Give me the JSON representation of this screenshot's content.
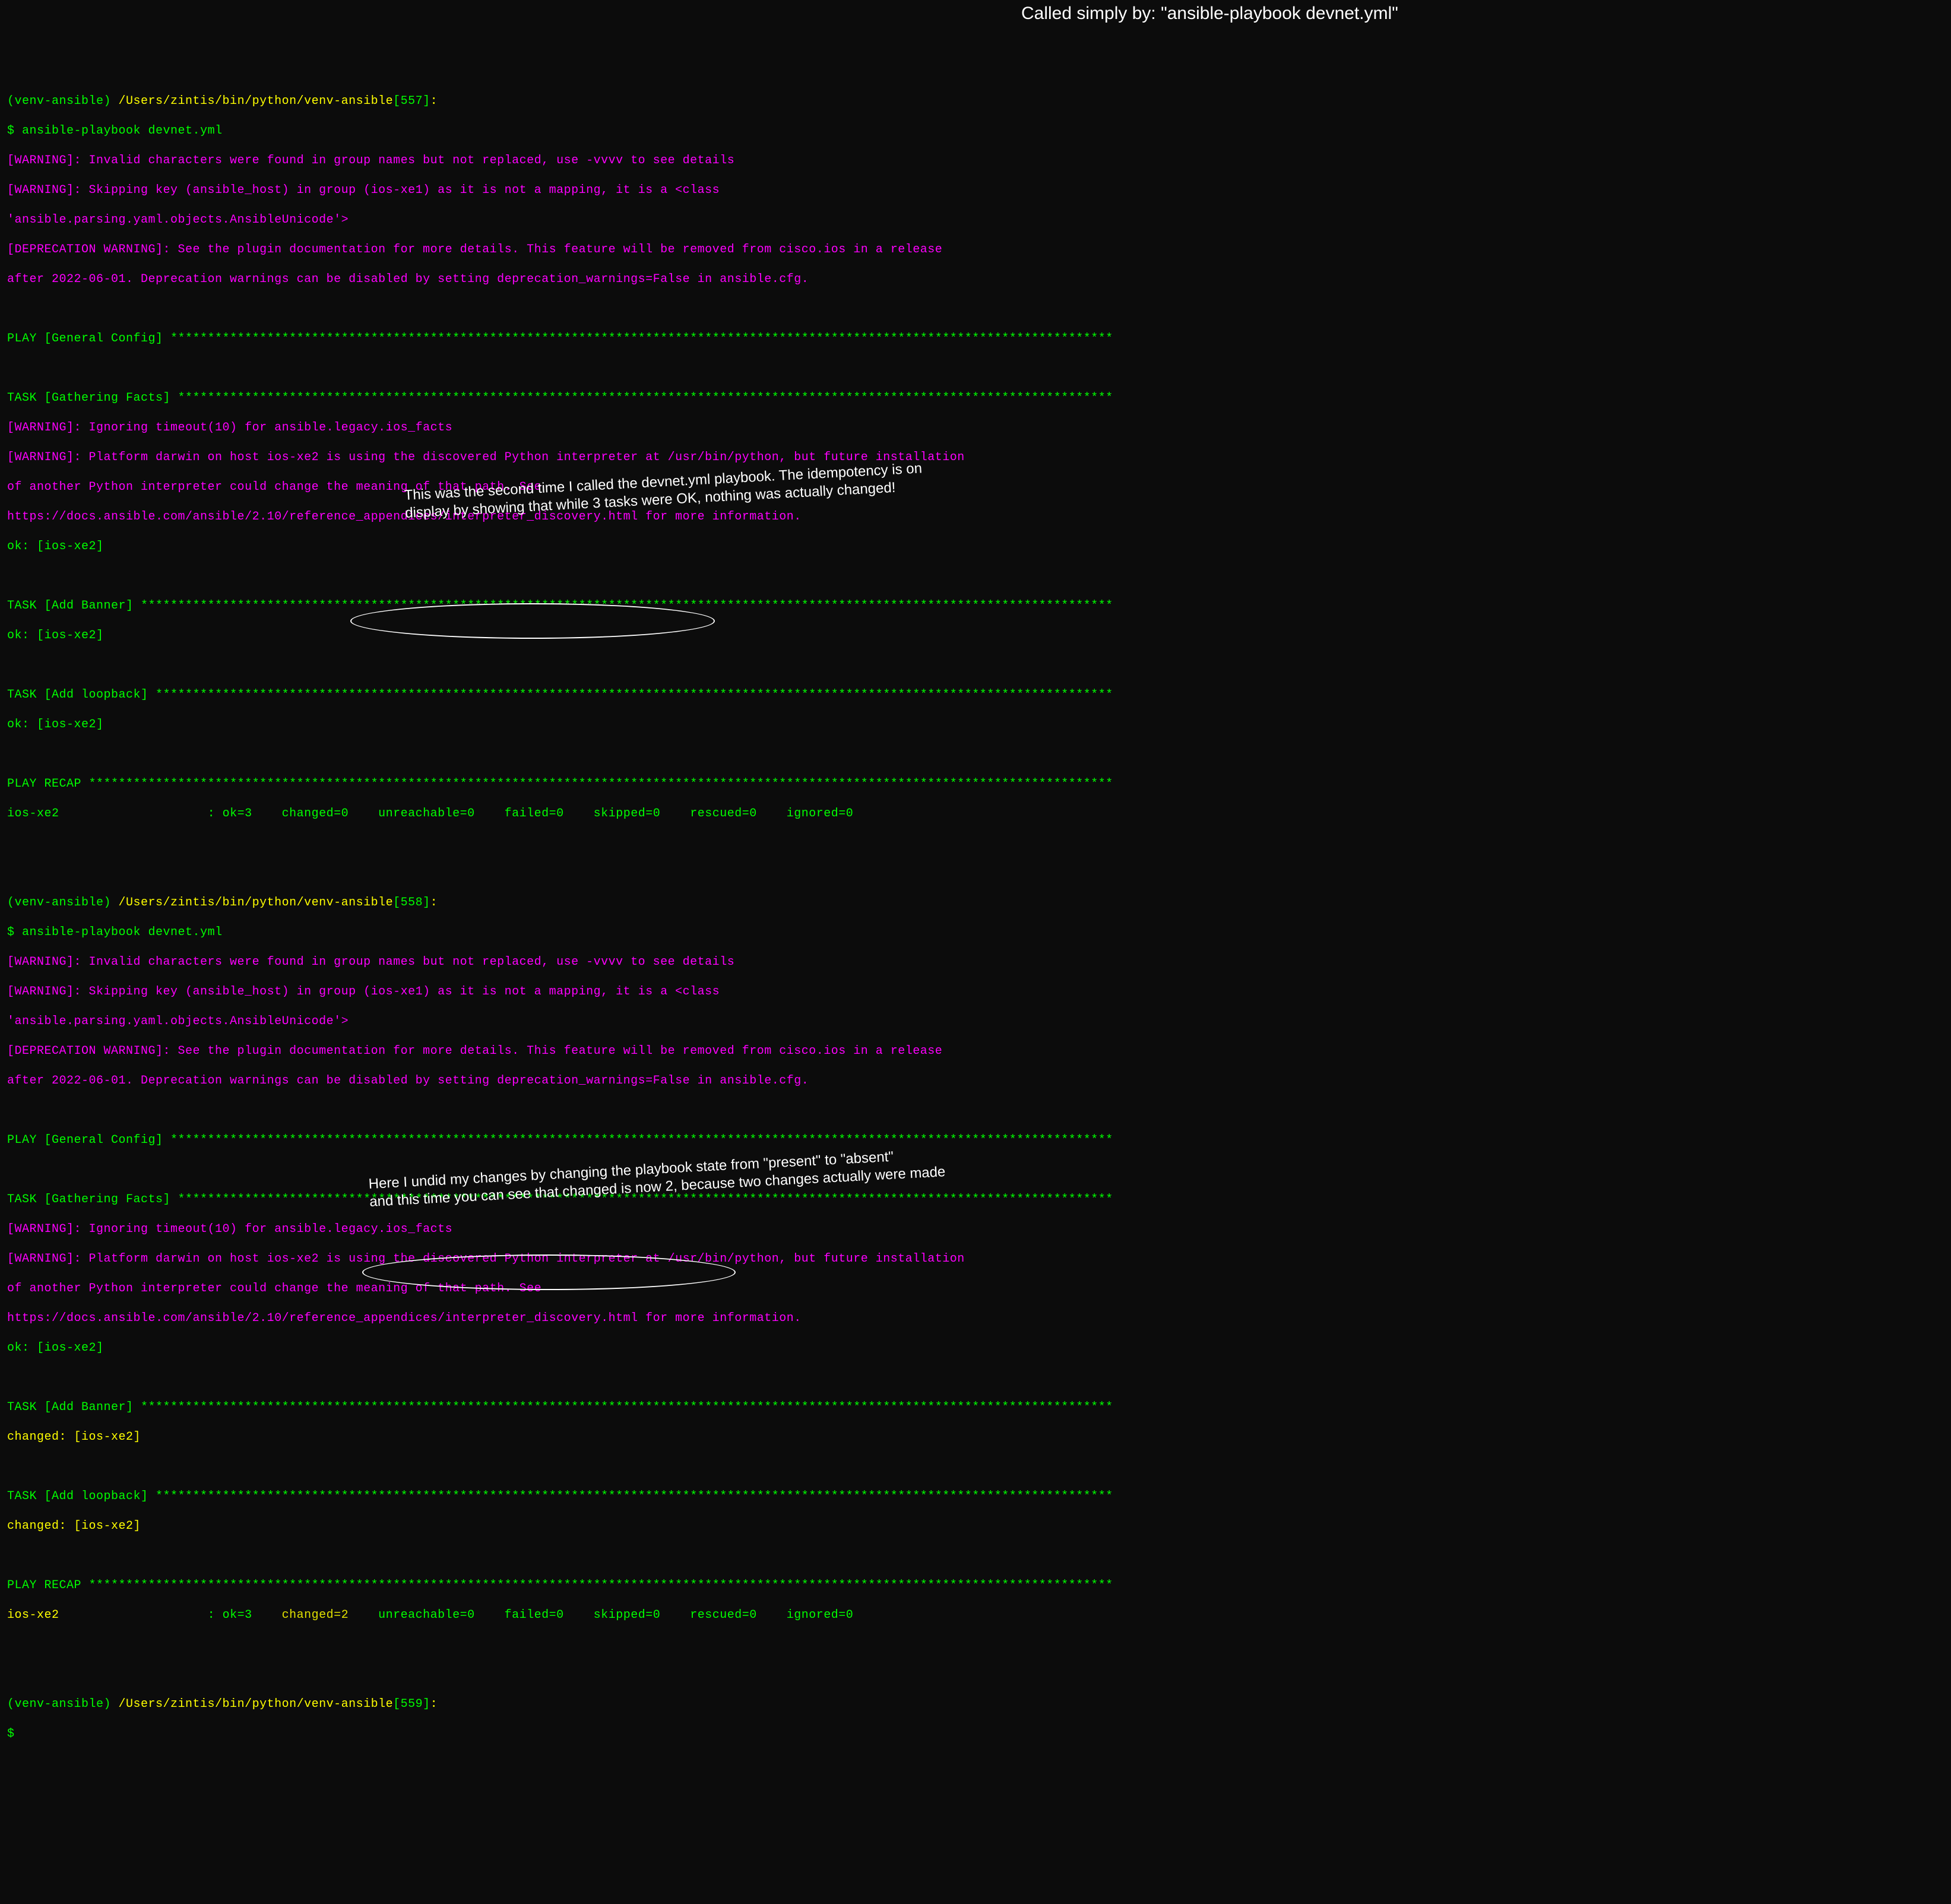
{
  "overlay": {
    "top_caption": "Called simply by: \"ansible-playbook devnet.yml\"",
    "mid_caption_l1": "This was the second time I called the devnet.yml playbook.  The idempotency is on",
    "mid_caption_l2": "display by showing that while 3 tasks were OK, nothing was actually changed!",
    "bot_caption_l1": "Here I undid my changes by changing the playbook state from \"present\" to \"absent\"",
    "bot_caption_l2": "and this time you can see that changed is now 2, because two changes actually were made"
  },
  "run1": {
    "prompt_prefix": "(venv-ansible) ",
    "prompt_path": "/Users/zintis/bin/python/venv-ansible",
    "prompt_num": "[557]",
    "prompt_colon": ":",
    "dollar": "$ ",
    "cmd": "ansible-playbook devnet.yml",
    "warn_groupnames": "[WARNING]: Invalid characters were found in group names but not replaced, use -vvvv to see details",
    "warn_skipkey_l1": "[WARNING]: Skipping key (ansible_host) in group (ios-xe1) as it is not a mapping, it is a <class",
    "warn_skipkey_l2": "'ansible.parsing.yaml.objects.AnsibleUnicode'>",
    "dep_l1": "[DEPRECATION WARNING]: See the plugin documentation for more details. This feature will be removed from cisco.ios in a release",
    "dep_l2": "after 2022-06-01. Deprecation warnings can be disabled by setting deprecation_warnings=False in ansible.cfg.",
    "play_gc_label": "PLAY [General Config] ",
    "play_gc_fill": "*******************************************************************************************************************************",
    "task_facts_label": "TASK [Gathering Facts] ",
    "task_facts_fill": "******************************************************************************************************************************",
    "warn_timeout": "[WARNING]: Ignoring timeout(10) for ansible.legacy.ios_facts",
    "warn_platform_l1": "[WARNING]: Platform darwin on host ios-xe2 is using the discovered Python interpreter at /usr/bin/python, but future installation",
    "warn_platform_l2": "of another Python interpreter could change the meaning of that path. See",
    "warn_platform_l3": "https://docs.ansible.com/ansible/2.10/reference_appendices/interpreter_discovery.html for more information.",
    "ok_host": "ok: [ios-xe2]",
    "task_banner_label": "TASK [Add Banner] ",
    "task_banner_fill": "***********************************************************************************************************************************",
    "task_loopback_label": "TASK [Add loopback] ",
    "task_loopback_fill": "*********************************************************************************************************************************",
    "recap_label": "PLAY RECAP ",
    "recap_fill": "******************************************************************************************************************************************",
    "recap_host": "ios-xe2                    ",
    "recap_sep": ": ",
    "recap_ok": "ok=3   ",
    "recap_changed": " changed=0   ",
    "recap_rest": " unreachable=0    failed=0    skipped=0    rescued=0    ignored=0"
  },
  "run2": {
    "prompt_prefix": "(venv-ansible) ",
    "prompt_path": "/Users/zintis/bin/python/venv-ansible",
    "prompt_num": "[558]",
    "prompt_colon": ":",
    "dollar": "$ ",
    "cmd": "ansible-playbook devnet.yml",
    "warn_groupnames": "[WARNING]: Invalid characters were found in group names but not replaced, use -vvvv to see details",
    "warn_skipkey_l1": "[WARNING]: Skipping key (ansible_host) in group (ios-xe1) as it is not a mapping, it is a <class",
    "warn_skipkey_l2": "'ansible.parsing.yaml.objects.AnsibleUnicode'>",
    "dep_l1": "[DEPRECATION WARNING]: See the plugin documentation for more details. This feature will be removed from cisco.ios in a release",
    "dep_l2": "after 2022-06-01. Deprecation warnings can be disabled by setting deprecation_warnings=False in ansible.cfg.",
    "play_gc_label": "PLAY [General Config] ",
    "play_gc_fill": "*******************************************************************************************************************************",
    "task_facts_label": "TASK [Gathering Facts] ",
    "task_facts_fill": "******************************************************************************************************************************",
    "warn_timeout": "[WARNING]: Ignoring timeout(10) for ansible.legacy.ios_facts",
    "warn_platform_l1": "[WARNING]: Platform darwin on host ios-xe2 is using the discovered Python interpreter at /usr/bin/python, but future installation",
    "warn_platform_l2": "of another Python interpreter could change the meaning of that path. See",
    "warn_platform_l3": "https://docs.ansible.com/ansible/2.10/reference_appendices/interpreter_discovery.html for more information.",
    "ok_host": "ok: [ios-xe2]",
    "task_banner_label": "TASK [Add Banner] ",
    "task_banner_fill": "***********************************************************************************************************************************",
    "changed_host": "changed: [ios-xe2]",
    "task_loopback_label": "TASK [Add loopback] ",
    "task_loopback_fill": "*********************************************************************************************************************************",
    "recap_label": "PLAY RECAP ",
    "recap_fill": "******************************************************************************************************************************************",
    "recap_host": "ios-xe2                    ",
    "recap_sep": ": ",
    "recap_ok": "ok=3   ",
    "recap_changed": " changed=2   ",
    "recap_rest": " unreachable=0    failed=0    skipped=0    rescued=0    ignored=0"
  },
  "final_prompt": {
    "prefix": "(venv-ansible) ",
    "path": "/Users/zintis/bin/python/venv-ansible",
    "num": "[559]",
    "colon": ":",
    "dollar": "$"
  }
}
